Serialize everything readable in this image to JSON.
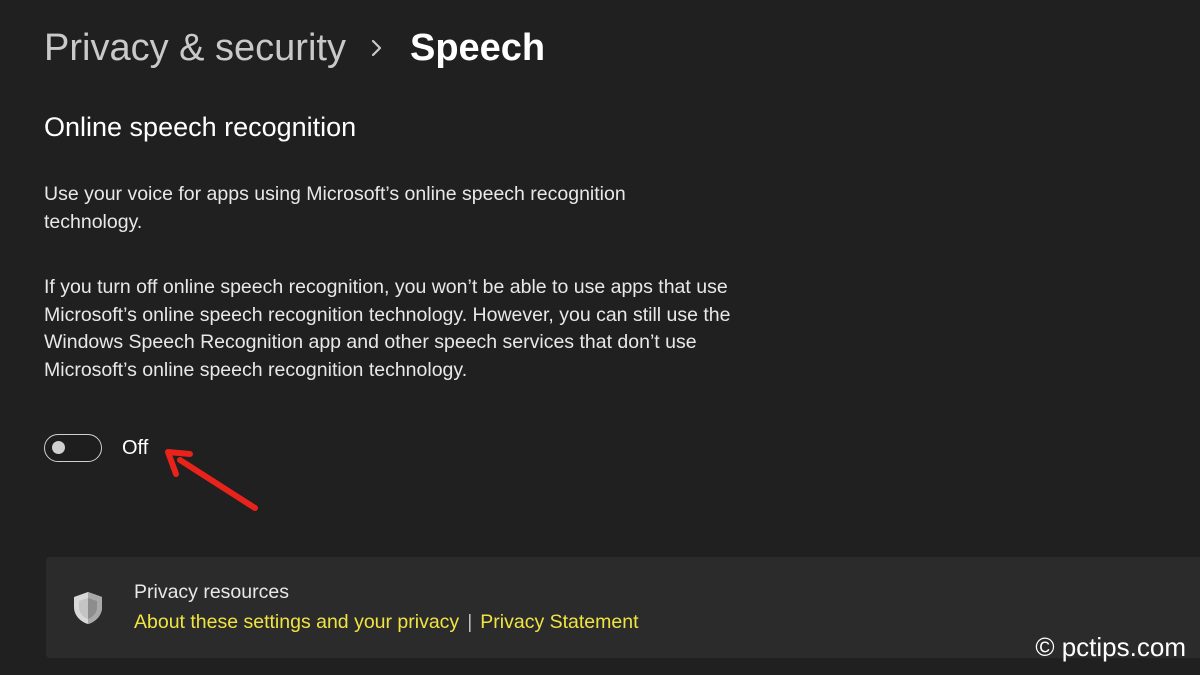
{
  "header": {
    "parent": "Privacy & security",
    "separator_icon": "chevron-right-icon",
    "current": "Speech"
  },
  "section": {
    "title": "Online speech recognition",
    "description_1": "Use your voice for apps using Microsoft’s online speech recognition technology.",
    "description_2": "If you turn off online speech recognition, you won’t be able to use apps that use Microsoft’s online speech recognition technology.  However, you can still use the Windows Speech Recognition app and other speech services that don’t use Microsoft’s online speech recognition technology."
  },
  "toggle": {
    "state": "off",
    "label": "Off"
  },
  "annotation": {
    "icon": "red-arrow-icon",
    "color": "#e8231b"
  },
  "privacy": {
    "icon": "shield-icon",
    "title": "Privacy resources",
    "link_1": "About these settings and your privacy",
    "separator": "|",
    "link_2": "Privacy Statement",
    "link_color": "#f0e442"
  },
  "watermark": {
    "text": "© pctips.com"
  },
  "colors": {
    "background": "#202020",
    "card": "#2b2b2b"
  }
}
